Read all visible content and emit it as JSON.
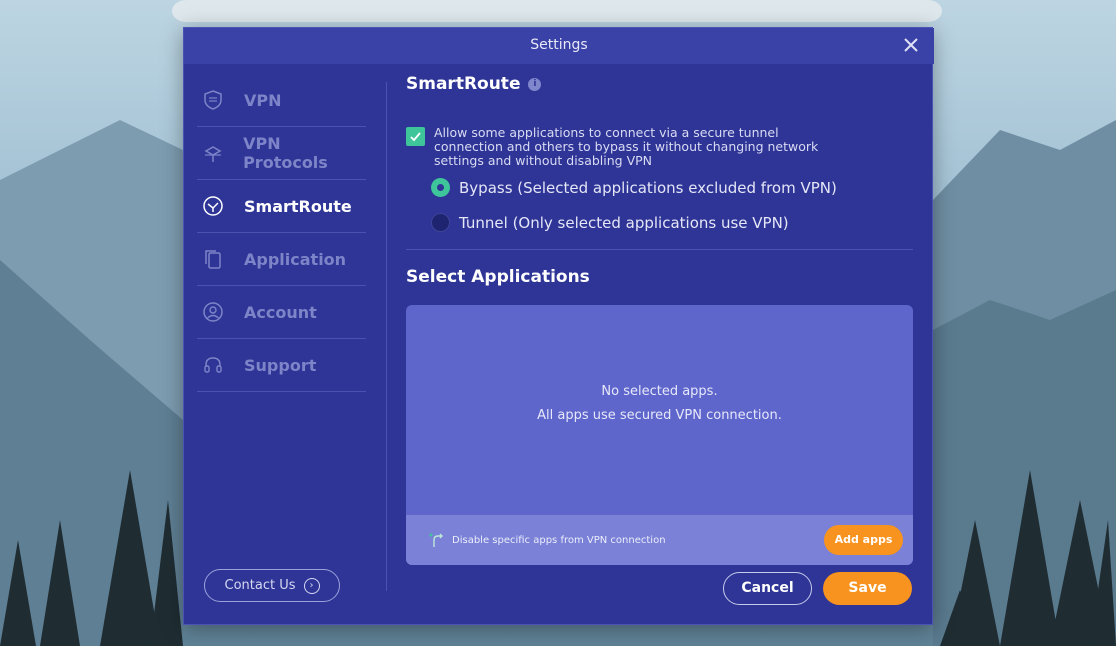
{
  "window": {
    "title": "Settings"
  },
  "sidebar": {
    "items": [
      {
        "label": "VPN",
        "icon": "shield-icon",
        "active": false
      },
      {
        "label": "VPN Protocols",
        "icon": "protocol-icon",
        "active": false
      },
      {
        "label": "SmartRoute",
        "icon": "smartroute-icon",
        "active": true
      },
      {
        "label": "Application",
        "icon": "application-icon",
        "active": false
      },
      {
        "label": "Account",
        "icon": "account-icon",
        "active": false
      },
      {
        "label": "Support",
        "icon": "headset-icon",
        "active": false
      }
    ],
    "contact_label": "Contact Us"
  },
  "smartroute": {
    "title": "SmartRoute",
    "checkbox_text": "Allow some applications to connect via a secure tunnel connection and others to bypass it without changing network settings and without disabling VPN",
    "checkbox_checked": true,
    "options": [
      {
        "label": "Bypass  (Selected applications excluded from VPN)",
        "selected": true
      },
      {
        "label": "Tunnel (Only selected applications use VPN)",
        "selected": false
      }
    ]
  },
  "apps": {
    "title": "Select Applications",
    "empty_line1": "No selected apps.",
    "empty_line2": "All apps use secured VPN connection.",
    "footer_hint": "Disable specific apps from VPN connection",
    "add_label": "Add apps"
  },
  "actions": {
    "cancel_label": "Cancel",
    "save_label": "Save"
  },
  "colors": {
    "dialog_bg": "#2e3596",
    "accent_green": "#3ec59a",
    "accent_orange": "#f7931e",
    "panel_bg": "#5e66cc"
  }
}
